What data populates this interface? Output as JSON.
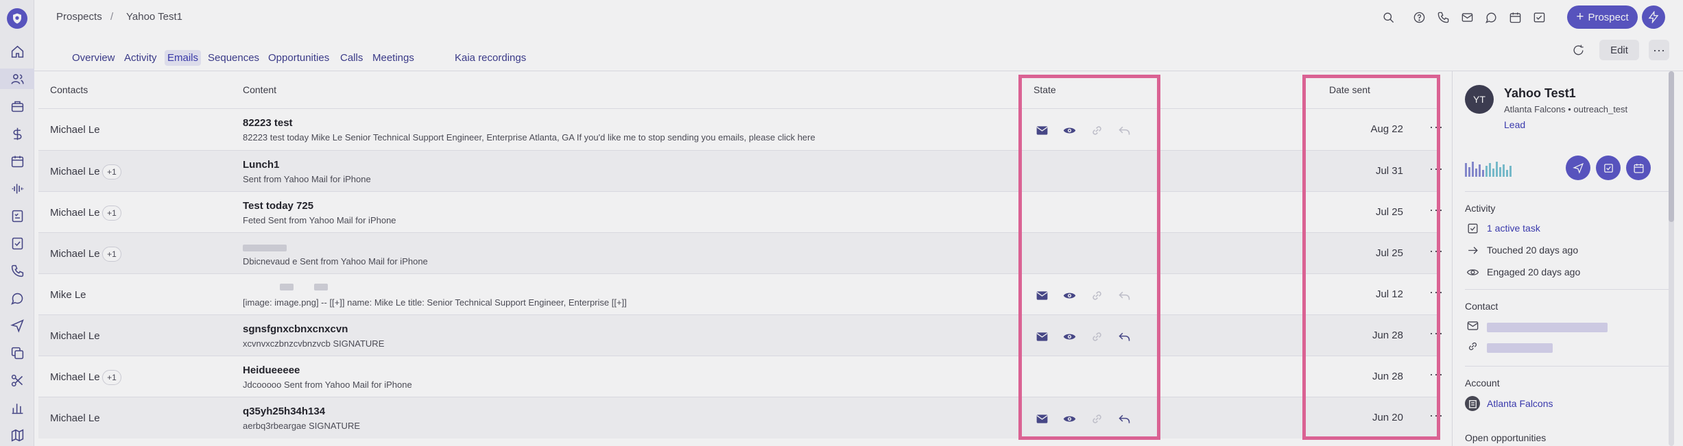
{
  "breadcrumb": {
    "parent": "Prospects",
    "separator": "/",
    "current": "Yahoo Test1"
  },
  "header": {
    "prospect_button": "Prospect",
    "prospect_plus": "+"
  },
  "tabs": [
    {
      "label": "Overview"
    },
    {
      "label": "Activity"
    },
    {
      "label": "Emails"
    },
    {
      "label": "Sequences"
    },
    {
      "label": "Opportunities"
    },
    {
      "label": "Calls"
    },
    {
      "label": "Meetings"
    },
    {
      "label": "Kaia recordings"
    }
  ],
  "toolbar": {
    "edit_label": "Edit",
    "more_label": "···"
  },
  "table": {
    "headers": {
      "contacts": "Contacts",
      "content": "Content",
      "state": "State",
      "date_sent": "Date sent"
    },
    "rows": [
      {
        "contact": "Michael Le",
        "badge": "",
        "subject": "82223 test",
        "snippet": "82223 test today Mike Le Senior Technical Support Engineer, Enterprise Atlanta, GA If you'd like me to stop sending you emails, please click here",
        "state": {
          "sent": true,
          "opened": true,
          "clicked": false,
          "replied": false
        },
        "date": "Aug 22",
        "more": "···"
      },
      {
        "contact": "Michael Le",
        "badge": "+1",
        "subject": "Lunch1",
        "snippet": "Sent from Yahoo Mail for iPhone",
        "state": null,
        "date": "Jul 31",
        "more": "···"
      },
      {
        "contact": "Michael Le",
        "badge": "+1",
        "subject": "Test today 725",
        "snippet": "Feted Sent from Yahoo Mail for iPhone",
        "state": null,
        "date": "Jul 25",
        "more": "···"
      },
      {
        "contact": "Michael Le",
        "badge": "+1",
        "subject": "",
        "snippet": "Dbicnevaud e Sent from Yahoo Mail for iPhone",
        "state": null,
        "date": "Jul 25",
        "more": "···"
      },
      {
        "contact": "Mike Le",
        "badge": "",
        "subject": "",
        "snippet": "[image: image.png] -- [[+]] name: Mike Le title: Senior Technical Support Engineer, Enterprise [[+]]",
        "state": {
          "sent": true,
          "opened": true,
          "clicked": false,
          "replied": false
        },
        "date": "Jul 12",
        "more": "···"
      },
      {
        "contact": "Michael Le",
        "badge": "",
        "subject": "sgnsfgnxcbnxcnxcvn",
        "snippet": "xcvnvxczbnzcvbnzvcb SIGNATURE",
        "state": {
          "sent": true,
          "opened": true,
          "clicked": false,
          "replied": true
        },
        "date": "Jun 28",
        "more": "···"
      },
      {
        "contact": "Michael Le",
        "badge": "+1",
        "subject": "Heidueeeee",
        "snippet": "Jdcooooo Sent from Yahoo Mail for iPhone",
        "state": null,
        "date": "Jun 28",
        "more": "···"
      },
      {
        "contact": "Michael Le",
        "badge": "",
        "subject": "q35yh25h34h134",
        "snippet": "aerbq3rbeargae SIGNATURE",
        "state": {
          "sent": true,
          "opened": true,
          "clicked": false,
          "replied": true
        },
        "date": "Jun 20",
        "more": "···"
      }
    ]
  },
  "panel": {
    "initials": "YT",
    "name": "Yahoo Test1",
    "subtitle": "Atlanta Falcons • outreach_test",
    "stage": "Lead",
    "activity_title": "Activity",
    "active_task": "1 active task",
    "touched": "Touched 20 days ago",
    "engaged": "Engaged 20 days ago",
    "contact_title": "Contact",
    "account_title": "Account",
    "account_name": "Atlanta Falcons",
    "opportunities_title": "Open opportunities"
  },
  "colors": {
    "brand": "#5b57c8",
    "highlight": "#e8679a",
    "link": "#3b3bb5"
  }
}
